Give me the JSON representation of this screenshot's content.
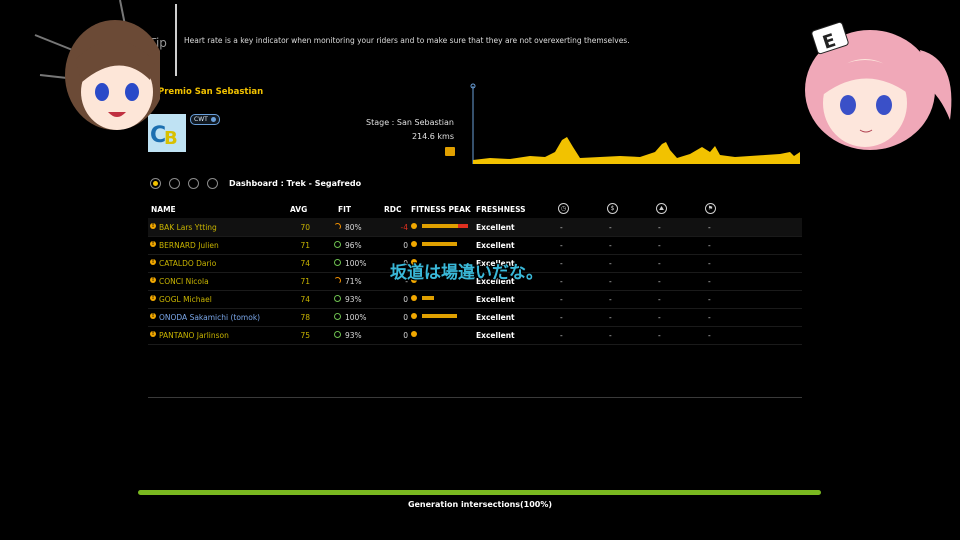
{
  "tip": {
    "label": "Tip",
    "text": "Heart rate is a key indicator when monitoring your riders and to make sure that they are not overexerting themselves."
  },
  "race": {
    "title": "n Premio San Sebastian",
    "badge": "CWT",
    "stage_name": "Stage : San Sebastian",
    "stage_distance": "214.6 kms"
  },
  "dashboard": {
    "title": "Dashboard : Trek - Segafredo"
  },
  "table": {
    "headers": {
      "name": "NAME",
      "avg": "AVG",
      "fit": "FIT",
      "rdc": "RDC",
      "fitness_peak": "FITNESS PEAK",
      "freshness": "FRESHNESS"
    },
    "header_icons": [
      "clock-icon",
      "dollar-icon",
      "mountain-icon",
      "flag-icon"
    ],
    "rows": [
      {
        "name": "BAK Lars Ytting",
        "avg": "70",
        "fit": "80%",
        "rdc": "-4",
        "freshness": "Excellent",
        "c1": "-",
        "c2": "-",
        "c3": "-",
        "c4": "-",
        "peak": 0.75,
        "peak_red": 0.2
      },
      {
        "name": "BERNARD Julien",
        "avg": "71",
        "fit": "96%",
        "rdc": "0",
        "freshness": "Excellent",
        "c1": "-",
        "c2": "-",
        "c3": "-",
        "c4": "-",
        "peak": 0.72,
        "peak_red": 0.0
      },
      {
        "name": "CATALDO Dario",
        "avg": "74",
        "fit": "100%",
        "rdc": "0",
        "freshness": "Excellent",
        "c1": "-",
        "c2": "-",
        "c3": "-",
        "c4": "-",
        "peak": 0.0,
        "peak_red": 0.0
      },
      {
        "name": "CONCI Nicola",
        "avg": "71",
        "fit": "71%",
        "rdc": "-",
        "freshness": "Excellent",
        "c1": "-",
        "c2": "-",
        "c3": "-",
        "c4": "-",
        "peak": 0.0,
        "peak_red": 0.0
      },
      {
        "name": "GOGL Michael",
        "avg": "74",
        "fit": "93%",
        "rdc": "0",
        "freshness": "Excellent",
        "c1": "-",
        "c2": "-",
        "c3": "-",
        "c4": "-",
        "peak": 0.25,
        "peak_red": 0.0
      },
      {
        "name": "ONODA Sakamichi (tomok)",
        "avg": "78",
        "fit": "100%",
        "rdc": "0",
        "freshness": "Excellent",
        "c1": "-",
        "c2": "-",
        "c3": "-",
        "c4": "-",
        "peak": 0.72,
        "peak_red": 0.0
      },
      {
        "name": "PANTANO Jarlinson",
        "avg": "75",
        "fit": "93%",
        "rdc": "0",
        "freshness": "Excellent",
        "c1": "-",
        "c2": "-",
        "c3": "-",
        "c4": "-",
        "peak": 0.0,
        "peak_red": 0.0
      }
    ]
  },
  "overlay": {
    "subtitle": "坂道は場違いだな。"
  },
  "footer": {
    "generation": "Generation intersections(100%)",
    "progress": 1.0
  },
  "colors": {
    "accent": "#f2c200",
    "progress": "#7ab820",
    "subtitle": "#3ab8d8"
  }
}
